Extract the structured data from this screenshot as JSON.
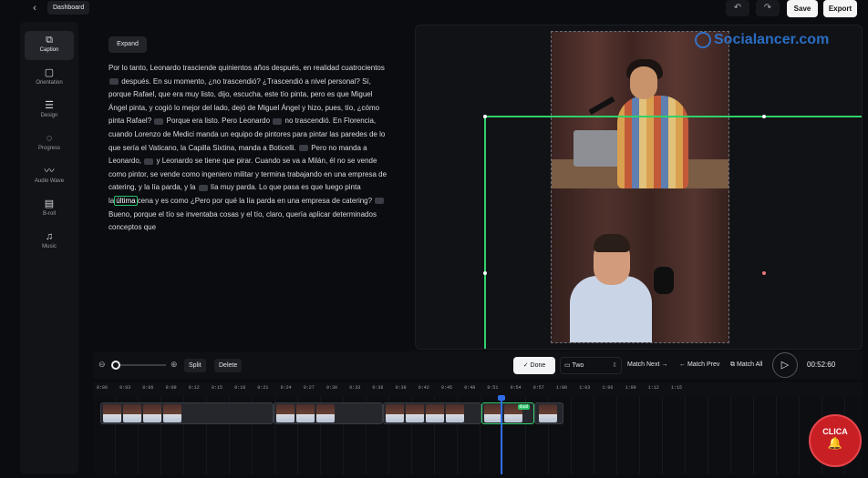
{
  "topbar": {
    "back_icon": "chevron-left-icon",
    "dashboard_label": "Dashboard",
    "undo_icon": "undo-icon",
    "redo_icon": "redo-icon",
    "save_label": "Save",
    "export_label": "Export"
  },
  "sidebar": {
    "items": [
      {
        "label": "Caption",
        "icon": "caption-icon",
        "glyph": "⧉",
        "active": true
      },
      {
        "label": "Orientation",
        "icon": "orientation-icon",
        "glyph": "▢"
      },
      {
        "label": "Design",
        "icon": "sliders-icon",
        "glyph": "☰"
      },
      {
        "label": "Progress",
        "icon": "progress-icon",
        "glyph": "◌"
      },
      {
        "label": "Audio Wave",
        "icon": "audio-wave-icon",
        "glyph": "〰"
      },
      {
        "label": "B-roll",
        "icon": "film-icon",
        "glyph": "▤"
      },
      {
        "label": "Music",
        "icon": "music-icon",
        "glyph": "♫"
      }
    ]
  },
  "transcript": {
    "expand_label": "Expand",
    "seg1": "Por lo tanto, Leonardo trasciende quinientos años después, en realidad cuatrocientos",
    "seg2": "después. En su momento, ¿no trascendió? ¿Trascendió a nivel personal? Sí, porque Rafael, que era muy listo, dijo, escucha, este tío pinta, pero es que Miguel Ángel pinta, y cogió lo mejor del lado, dejó de Miguel Ángel y hizo, pues, tío, ¿cómo pinta Rafael?",
    "seg3": "Porque era listo. Pero Leonardo",
    "seg4": "no trascendió. En Florencia, cuando Lorenzo de Medici manda un equipo de pintores para pintar las paredes de lo que sería el Vaticano, la Capilla Sixtina, manda a Boticelli.",
    "seg5": "Pero no manda a Leonardo,",
    "seg6": "y Leonardo se tiene que pirar. Cuando se va a Milán, él no se vende como pintor, se vende como ingeniero militar y termina trabajando en una empresa de catering, y la lía parda, y la",
    "seg7": "lía muy parda. Lo que pasa es que luego pinta la",
    "highlight": "última",
    "seg8": "cena y es como ¿Pero por qué la lía parda en una empresa de catering?",
    "seg9": "Bueno, porque el tío se inventaba cosas y el tío, claro, quería aplicar determinados conceptos que"
  },
  "preview": {
    "watermark": "Socialancer.com"
  },
  "timeline": {
    "zoom_out_icon": "zoom-out-icon",
    "zoom_in_icon": "zoom-in-icon",
    "zoom_level": 0.1,
    "split_label": "Split",
    "delete_label": "Delete",
    "done_label": "Done",
    "layout_select": "Two",
    "match_next": "Match Next →",
    "match_prev": "← Match Prev",
    "match_all": "Match All",
    "timecode": "00:52:60",
    "ticks": [
      "0:00",
      "0:03",
      "0:06",
      "0:09",
      "0:12",
      "0:15",
      "0:18",
      "0:21",
      "0:24",
      "0:27",
      "0:30",
      "0:33",
      "0:36",
      "0:39",
      "0:42",
      "0:45",
      "0:48",
      "0:51",
      "0:54",
      "0:57",
      "1:00",
      "1:03",
      "1:06",
      "1:09",
      "1:12",
      "1:15"
    ],
    "selected_clip_tag": "dual"
  },
  "overlay": {
    "clica_label": "CLICA",
    "bell_icon": "bell-icon"
  }
}
